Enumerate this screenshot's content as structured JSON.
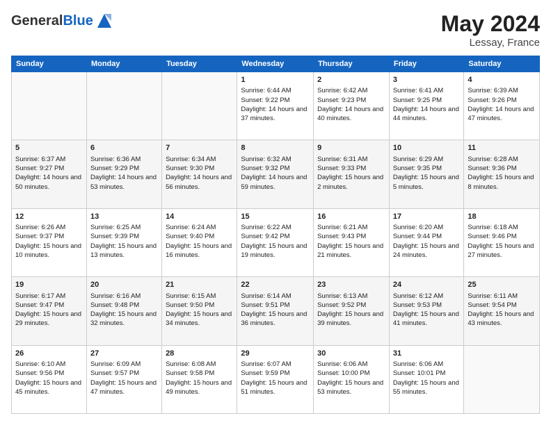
{
  "header": {
    "logo_general": "General",
    "logo_blue": "Blue",
    "title": "May 2024",
    "location": "Lessay, France"
  },
  "days_of_week": [
    "Sunday",
    "Monday",
    "Tuesday",
    "Wednesday",
    "Thursday",
    "Friday",
    "Saturday"
  ],
  "weeks": [
    [
      {
        "day": "",
        "info": ""
      },
      {
        "day": "",
        "info": ""
      },
      {
        "day": "",
        "info": ""
      },
      {
        "day": "1",
        "info": "Sunrise: 6:44 AM\nSunset: 9:22 PM\nDaylight: 14 hours and 37 minutes."
      },
      {
        "day": "2",
        "info": "Sunrise: 6:42 AM\nSunset: 9:23 PM\nDaylight: 14 hours and 40 minutes."
      },
      {
        "day": "3",
        "info": "Sunrise: 6:41 AM\nSunset: 9:25 PM\nDaylight: 14 hours and 44 minutes."
      },
      {
        "day": "4",
        "info": "Sunrise: 6:39 AM\nSunset: 9:26 PM\nDaylight: 14 hours and 47 minutes."
      }
    ],
    [
      {
        "day": "5",
        "info": "Sunrise: 6:37 AM\nSunset: 9:27 PM\nDaylight: 14 hours and 50 minutes."
      },
      {
        "day": "6",
        "info": "Sunrise: 6:36 AM\nSunset: 9:29 PM\nDaylight: 14 hours and 53 minutes."
      },
      {
        "day": "7",
        "info": "Sunrise: 6:34 AM\nSunset: 9:30 PM\nDaylight: 14 hours and 56 minutes."
      },
      {
        "day": "8",
        "info": "Sunrise: 6:32 AM\nSunset: 9:32 PM\nDaylight: 14 hours and 59 minutes."
      },
      {
        "day": "9",
        "info": "Sunrise: 6:31 AM\nSunset: 9:33 PM\nDaylight: 15 hours and 2 minutes."
      },
      {
        "day": "10",
        "info": "Sunrise: 6:29 AM\nSunset: 9:35 PM\nDaylight: 15 hours and 5 minutes."
      },
      {
        "day": "11",
        "info": "Sunrise: 6:28 AM\nSunset: 9:36 PM\nDaylight: 15 hours and 8 minutes."
      }
    ],
    [
      {
        "day": "12",
        "info": "Sunrise: 6:26 AM\nSunset: 9:37 PM\nDaylight: 15 hours and 10 minutes."
      },
      {
        "day": "13",
        "info": "Sunrise: 6:25 AM\nSunset: 9:39 PM\nDaylight: 15 hours and 13 minutes."
      },
      {
        "day": "14",
        "info": "Sunrise: 6:24 AM\nSunset: 9:40 PM\nDaylight: 15 hours and 16 minutes."
      },
      {
        "day": "15",
        "info": "Sunrise: 6:22 AM\nSunset: 9:42 PM\nDaylight: 15 hours and 19 minutes."
      },
      {
        "day": "16",
        "info": "Sunrise: 6:21 AM\nSunset: 9:43 PM\nDaylight: 15 hours and 21 minutes."
      },
      {
        "day": "17",
        "info": "Sunrise: 6:20 AM\nSunset: 9:44 PM\nDaylight: 15 hours and 24 minutes."
      },
      {
        "day": "18",
        "info": "Sunrise: 6:18 AM\nSunset: 9:46 PM\nDaylight: 15 hours and 27 minutes."
      }
    ],
    [
      {
        "day": "19",
        "info": "Sunrise: 6:17 AM\nSunset: 9:47 PM\nDaylight: 15 hours and 29 minutes."
      },
      {
        "day": "20",
        "info": "Sunrise: 6:16 AM\nSunset: 9:48 PM\nDaylight: 15 hours and 32 minutes."
      },
      {
        "day": "21",
        "info": "Sunrise: 6:15 AM\nSunset: 9:50 PM\nDaylight: 15 hours and 34 minutes."
      },
      {
        "day": "22",
        "info": "Sunrise: 6:14 AM\nSunset: 9:51 PM\nDaylight: 15 hours and 36 minutes."
      },
      {
        "day": "23",
        "info": "Sunrise: 6:13 AM\nSunset: 9:52 PM\nDaylight: 15 hours and 39 minutes."
      },
      {
        "day": "24",
        "info": "Sunrise: 6:12 AM\nSunset: 9:53 PM\nDaylight: 15 hours and 41 minutes."
      },
      {
        "day": "25",
        "info": "Sunrise: 6:11 AM\nSunset: 9:54 PM\nDaylight: 15 hours and 43 minutes."
      }
    ],
    [
      {
        "day": "26",
        "info": "Sunrise: 6:10 AM\nSunset: 9:56 PM\nDaylight: 15 hours and 45 minutes."
      },
      {
        "day": "27",
        "info": "Sunrise: 6:09 AM\nSunset: 9:57 PM\nDaylight: 15 hours and 47 minutes."
      },
      {
        "day": "28",
        "info": "Sunrise: 6:08 AM\nSunset: 9:58 PM\nDaylight: 15 hours and 49 minutes."
      },
      {
        "day": "29",
        "info": "Sunrise: 6:07 AM\nSunset: 9:59 PM\nDaylight: 15 hours and 51 minutes."
      },
      {
        "day": "30",
        "info": "Sunrise: 6:06 AM\nSunset: 10:00 PM\nDaylight: 15 hours and 53 minutes."
      },
      {
        "day": "31",
        "info": "Sunrise: 6:06 AM\nSunset: 10:01 PM\nDaylight: 15 hours and 55 minutes."
      },
      {
        "day": "",
        "info": ""
      }
    ]
  ]
}
